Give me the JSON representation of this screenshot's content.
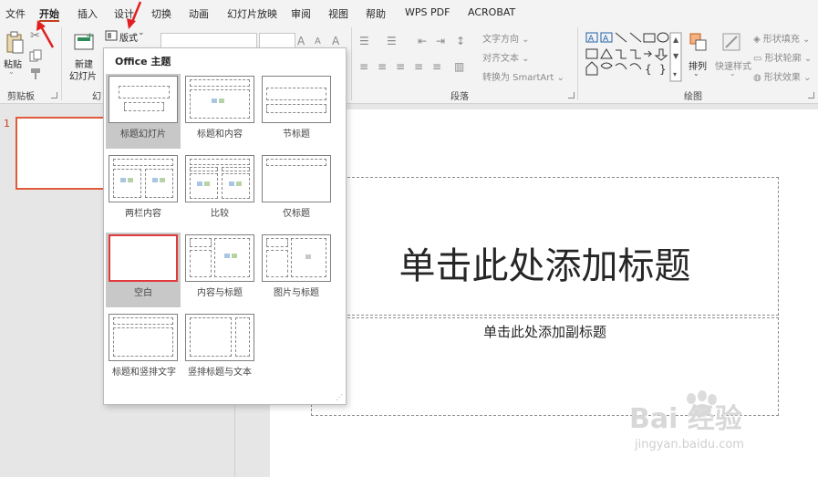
{
  "menu_tabs": [
    "文件",
    "开始",
    "插入",
    "设计",
    "切换",
    "动画",
    "幻灯片放映",
    "审阅",
    "视图",
    "帮助",
    "WPS PDF",
    "ACROBAT"
  ],
  "ribbon": {
    "paste_label": "粘贴",
    "new_slide_label": "新建",
    "new_slide_label2": "幻灯片",
    "layout_label": "版式",
    "clipboard_group": "剪贴板",
    "slides_group": "幻",
    "paragraph_group": "段落",
    "drawing_group": "绘图",
    "text_direction": "文字方向",
    "align_text": "对齐文本",
    "convert_smartart": "转换为 SmartArt",
    "arrange_label": "排列",
    "quick_styles_label": "快速样式",
    "shape_fill": "形状填充",
    "shape_outline": "形状轮廓",
    "shape_effects": "形状效果"
  },
  "thumbnail_number": "1",
  "slide": {
    "title_placeholder": "单击此处添加标题",
    "subtitle_placeholder": "单击此处添加副标题"
  },
  "layout_menu": {
    "header": "Office 主题",
    "layouts": [
      "标题幻灯片",
      "标题和内容",
      "节标题",
      "两栏内容",
      "比较",
      "仅标题",
      "空白",
      "内容与标题",
      "图片与标题",
      "标题和竖排文字",
      "竖排标题与文本"
    ]
  },
  "watermark": {
    "brand": "Bai 经验",
    "url": "jingyan.baidu.com"
  },
  "colors": {
    "accent": "#c43e1c",
    "highlight": "#e03b3b",
    "selected_bg": "#c8c8c8"
  }
}
